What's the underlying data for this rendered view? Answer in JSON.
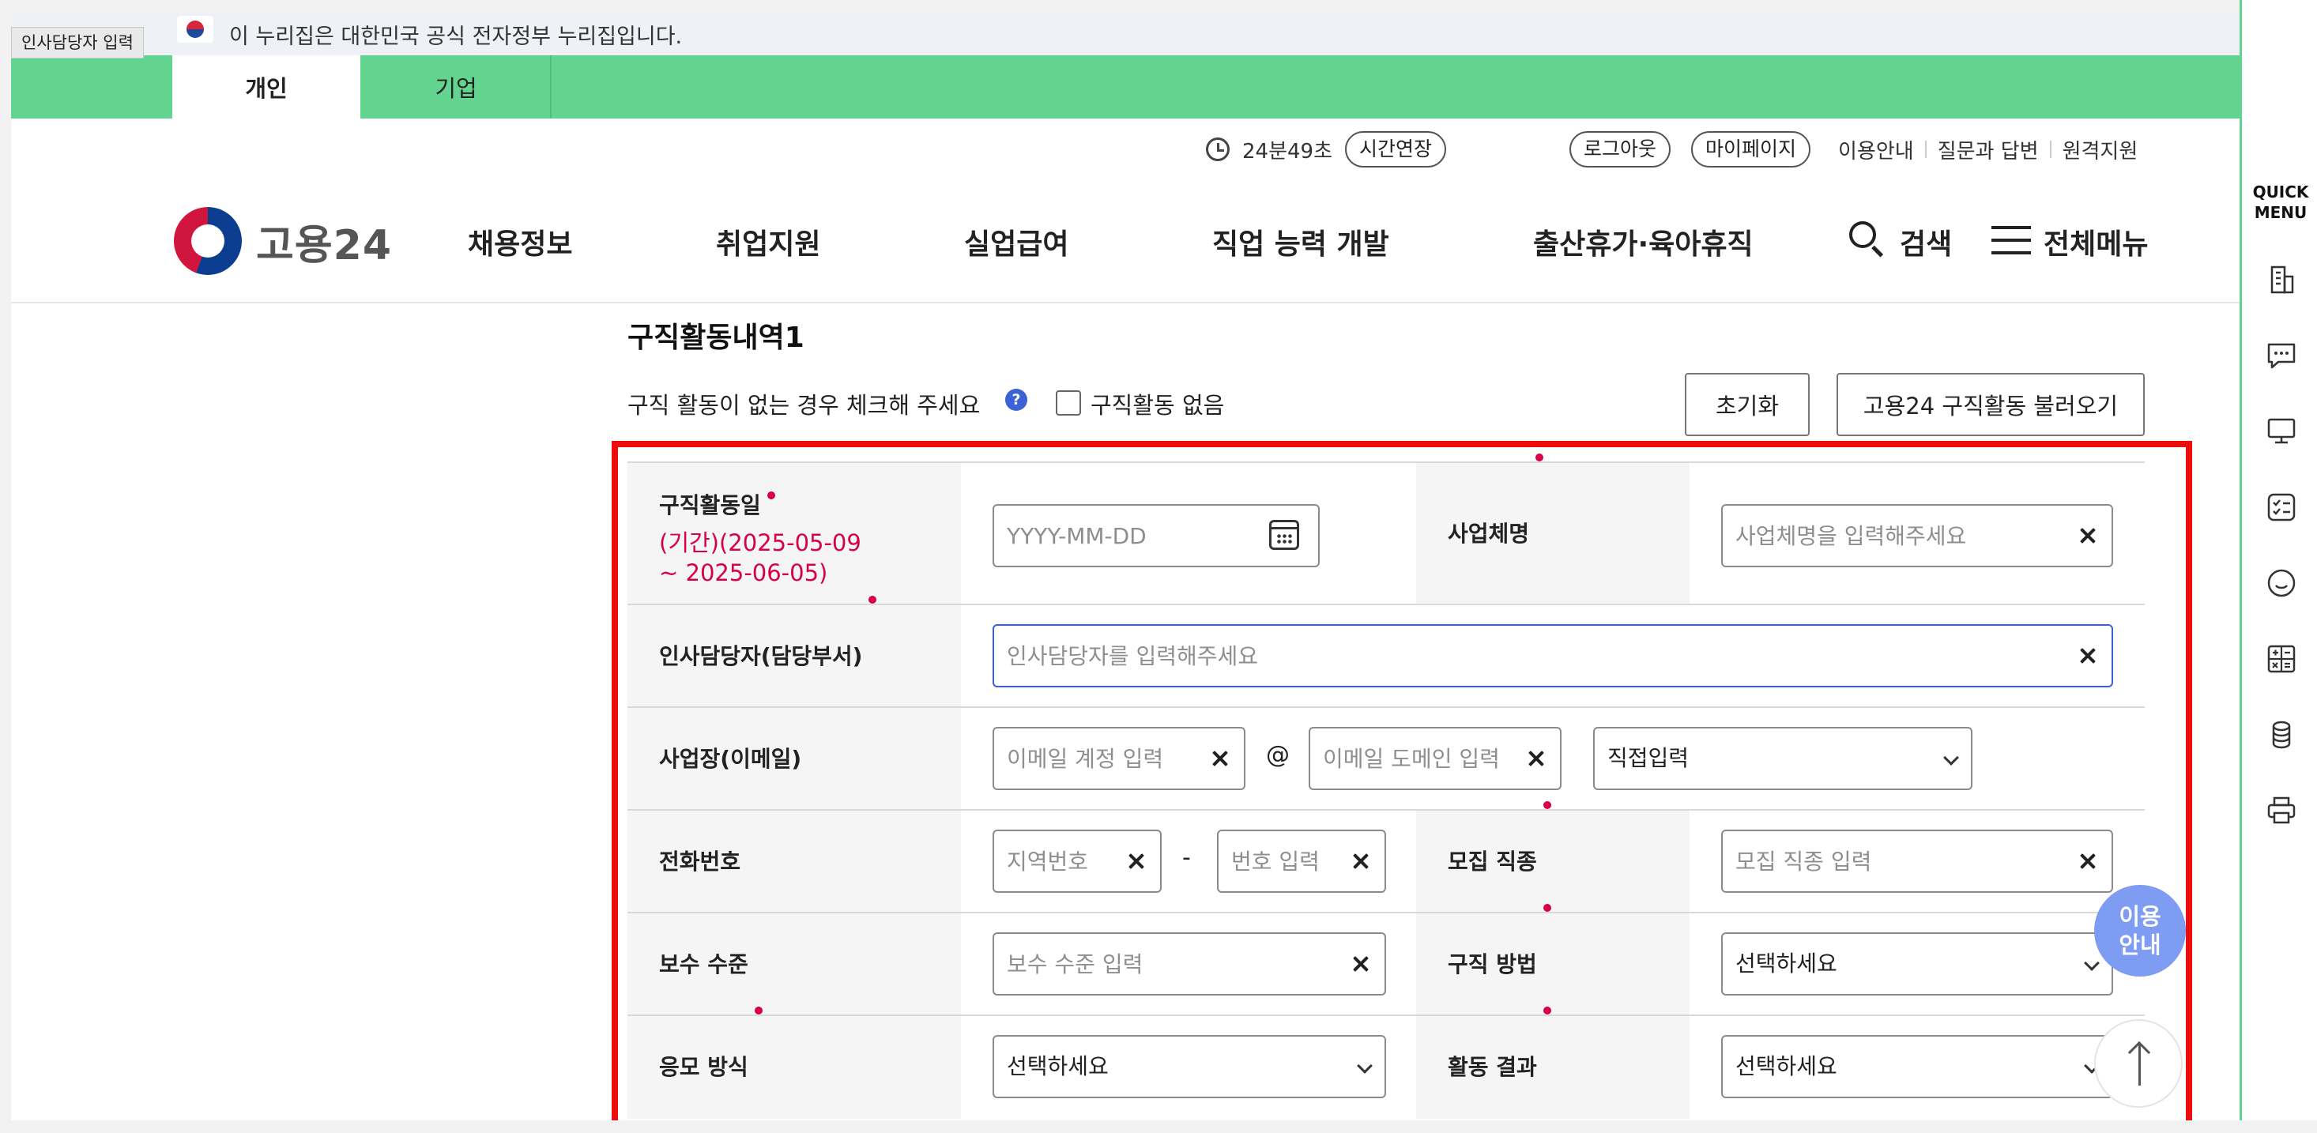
{
  "tooltip": "인사담당자 입력",
  "gov_banner": {
    "text": "이 누리집은 대한민국 공식 전자정부 누리집입니다."
  },
  "tabs": [
    {
      "label": "개인",
      "active": true
    },
    {
      "label": "기업",
      "active": false
    }
  ],
  "utility": {
    "timer": "24분49초",
    "extend_label": "시간연장",
    "logout_label": "로그아웃",
    "mypage_label": "마이페이지",
    "links": [
      "이용안내",
      "질문과 답변",
      "원격지원"
    ]
  },
  "logo": {
    "text": "고용24"
  },
  "nav": {
    "items": [
      "채용정보",
      "취업지원",
      "실업급여",
      "직업 능력 개발",
      "출산휴가·육아휴직"
    ],
    "search_label": "검색",
    "menu_label": "전체메뉴"
  },
  "quick_menu": {
    "title_line1": "QUICK",
    "title_line2": "MENU"
  },
  "section": {
    "title": "구직활동내역1",
    "hint": "구직 활동이 없는 경우 체크해 주세요",
    "no_activity_label": "구직활동 없음",
    "reset_label": "초기화",
    "load_label": "고용24 구직활동 불러오기"
  },
  "form": {
    "activity_date": {
      "label": "구직활동일",
      "period_line1": "(기간)(2025-05-09",
      "period_line2": "~ 2025-06-05)",
      "placeholder": "YYYY-MM-DD"
    },
    "company": {
      "label": "사업체명",
      "placeholder": "사업체명을 입력해주세요"
    },
    "hr_contact": {
      "label": "인사담당자(담당부서)",
      "placeholder": "인사담당자를 입력해주세요"
    },
    "email": {
      "label": "사업장(이메일)",
      "account_placeholder": "이메일 계정 입력",
      "at": "@",
      "domain_placeholder": "이메일 도메인 입력",
      "domain_select": "직접입력"
    },
    "phone": {
      "label": "전화번호",
      "area_placeholder": "지역번호",
      "dash": "-",
      "number_placeholder": "번호 입력"
    },
    "job_type": {
      "label": "모집 직종",
      "placeholder": "모집 직종 입력"
    },
    "salary": {
      "label": "보수 수준",
      "placeholder": "보수 수준 입력"
    },
    "search_method": {
      "label": "구직 방법",
      "value": "선택하세요"
    },
    "apply_method": {
      "label": "응모 방식",
      "value": "선택하세요"
    },
    "result": {
      "label": "활동 결과",
      "value": "선택하세요"
    }
  },
  "floating": {
    "guide_line1": "이용",
    "guide_line2": "안내"
  },
  "colors": {
    "accent_green": "#62d48f",
    "highlight_red": "#ee0d0d",
    "required_dot": "#d6004c",
    "focus_blue": "#3d5ed6",
    "guide_blue": "#7d9cf2"
  }
}
